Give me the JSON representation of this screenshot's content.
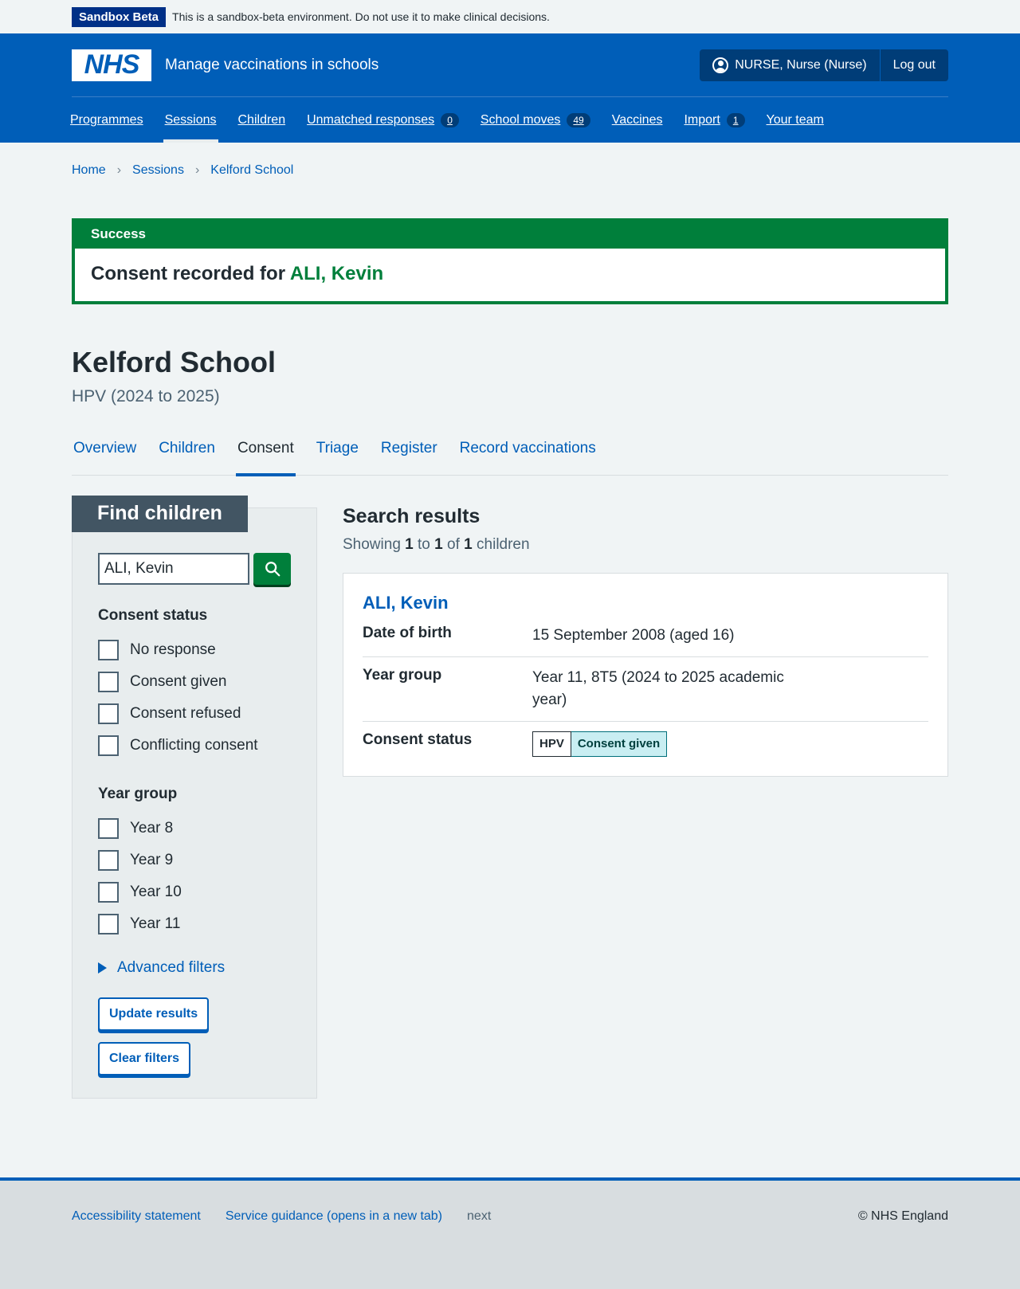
{
  "beta": {
    "tag": "Sandbox Beta",
    "text": "This is a sandbox-beta environment. Do not use it to make clinical decisions."
  },
  "header": {
    "logo": "NHS",
    "service_name": "Manage vaccinations in schools",
    "user": "NURSE, Nurse (Nurse)",
    "logout": "Log out",
    "nav": [
      {
        "label": "Programmes"
      },
      {
        "label": "Sessions"
      },
      {
        "label": "Children"
      },
      {
        "label": "Unmatched responses",
        "count": "0"
      },
      {
        "label": "School moves",
        "count": "49"
      },
      {
        "label": "Vaccines"
      },
      {
        "label": "Import",
        "count": "1"
      },
      {
        "label": "Your team"
      }
    ]
  },
  "breadcrumb": [
    "Home",
    "Sessions",
    "Kelford School"
  ],
  "success": {
    "heading": "Success",
    "text": "Consent recorded for",
    "link": "ALI, Kevin"
  },
  "page": {
    "title": "Kelford School",
    "caption": "HPV (2024 to 2025)"
  },
  "tabs": [
    "Overview",
    "Children",
    "Consent",
    "Triage",
    "Register",
    "Record vaccinations"
  ],
  "filter": {
    "heading": "Find children",
    "search_value": "ALI, Kevin",
    "consent_legend": "Consent status",
    "consent_options": [
      "No response",
      "Consent given",
      "Consent refused",
      "Conflicting consent"
    ],
    "year_legend": "Year group",
    "year_options": [
      "Year 8",
      "Year 9",
      "Year 10",
      "Year 11"
    ],
    "advanced": "Advanced filters",
    "update_button": "Update results",
    "clear_button": "Clear filters"
  },
  "results": {
    "title": "Search results",
    "showing": "Showing",
    "from": "1",
    "to_word": "to",
    "to": "1",
    "of_word": "of",
    "total": "1",
    "suffix": "children",
    "card": {
      "name": "ALI, Kevin",
      "rows": [
        {
          "key": "Date of birth",
          "value": "15 September 2008 (aged 16)"
        },
        {
          "key": "Year group",
          "value": "Year 11, 8T5 (2024 to 2025 academic year)"
        },
        {
          "key": "Consent status"
        }
      ],
      "programme_tag": "HPV",
      "status_tag": "Consent given"
    }
  },
  "footer": {
    "links": [
      "Accessibility statement",
      "Service guidance (opens in a new tab)"
    ],
    "version": "next",
    "copyright": "© NHS England"
  }
}
